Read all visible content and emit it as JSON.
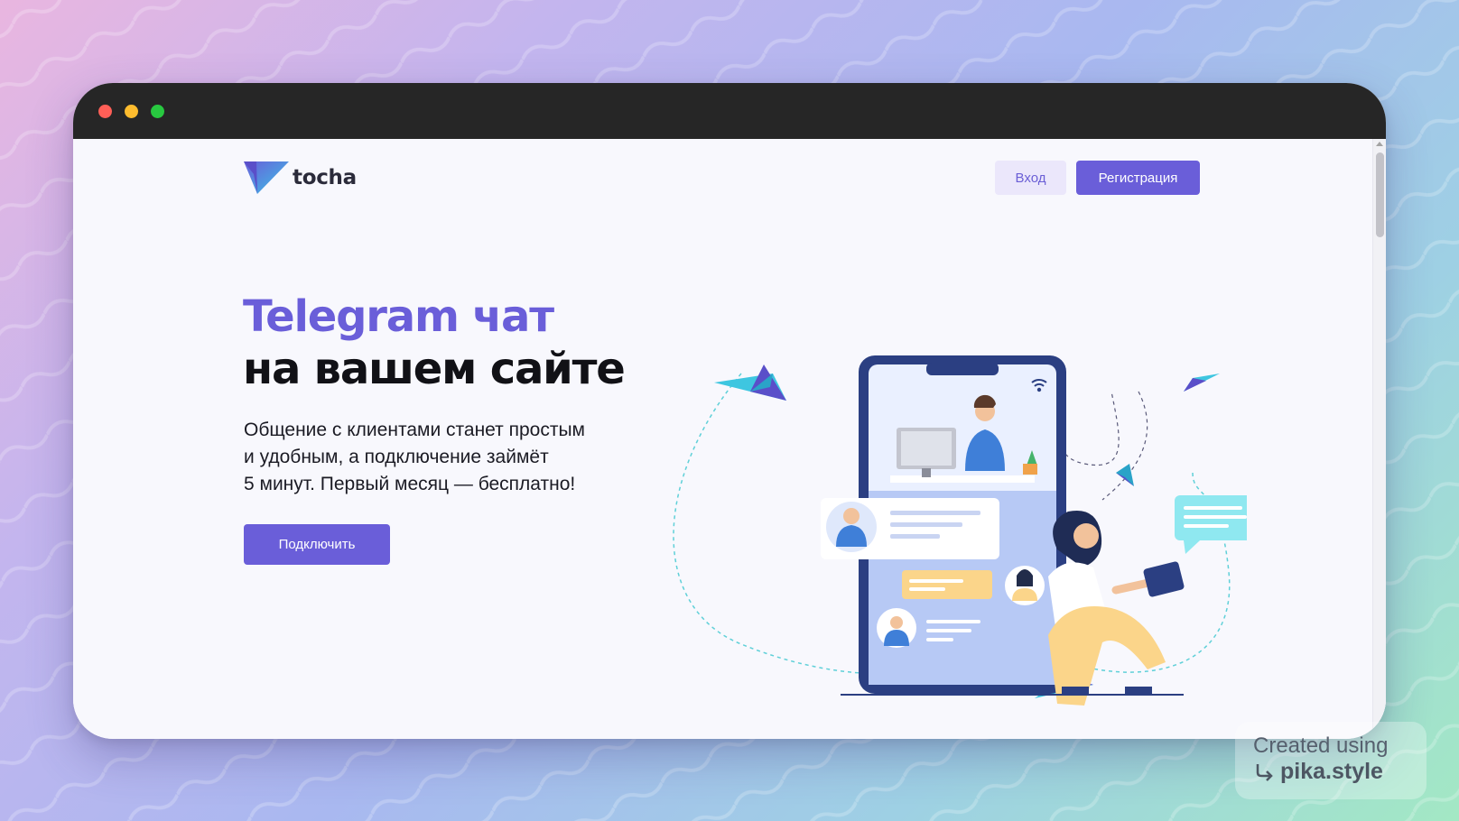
{
  "window": {
    "controls": [
      "close",
      "minimize",
      "maximize"
    ]
  },
  "header": {
    "logo_text": "tocha",
    "login_label": "Вход",
    "register_label": "Регистрация"
  },
  "hero": {
    "title_line1": "Telegram чат",
    "title_line2": "на вашем сайте",
    "desc_lines": [
      "Общение с клиентами станет простым",
      "и удобным, а подключение займёт",
      "5 минут. Первый месяц — бесплатно!"
    ],
    "connect_label": "Подключить"
  },
  "watermark": {
    "line1": "Created using",
    "line2": "pika.style"
  },
  "colors": {
    "accent": "#6a5ed9",
    "titlebar": "#262626",
    "page_bg": "#f8f8fd",
    "login_bg": "#ebe7fb"
  },
  "icons": [
    "logo-mark-icon",
    "wifi-icon",
    "paper-plane-icon",
    "arrow-return-icon"
  ]
}
